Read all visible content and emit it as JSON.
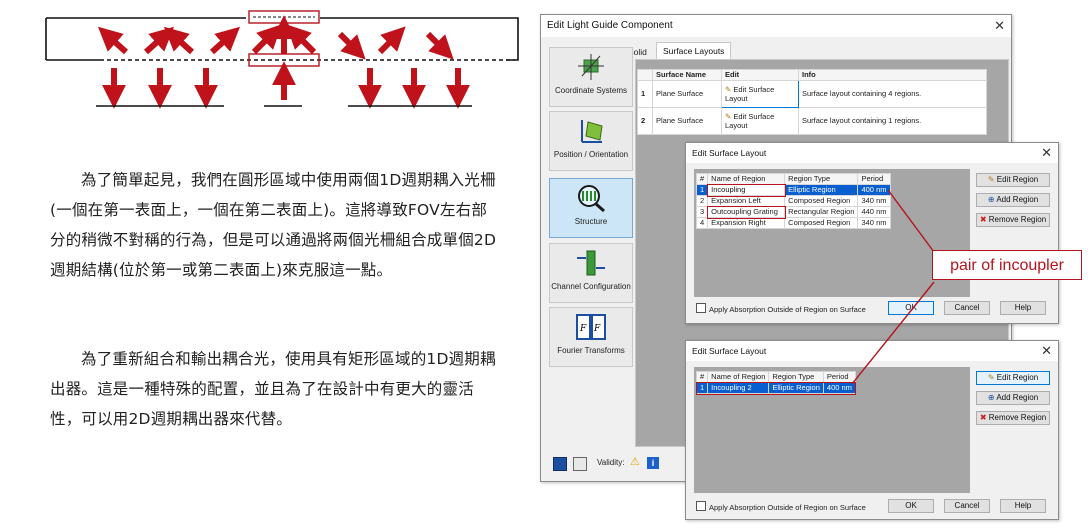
{
  "article": {
    "paragraph1": "為了簡單起見，我們在圓形區域中使用兩個1D週期耦入光柵(一個在第一表面上，一個在第二表面上)。這將導致FOV左右部分的稍微不對稱的行為，但是可以通過將兩個光柵組合成單個2D週期結構(位於第一或第二表面上)來克服這一點。",
    "paragraph2": "為了重新組合和輸出耦合光，使用具有矩形區域的1D週期耦出器。這是一種特殊的配置，並且為了在設計中有更大的靈活性，可以用2D週期耦出器來代替。"
  },
  "colors": {
    "arrow": "#c0121a",
    "annotation": "#b4141e",
    "selection": "#0a5fd0"
  },
  "main_dialog": {
    "title": "Edit Light Guide Component",
    "close": "✕",
    "tabs": [
      "Solid",
      "Surface Layouts"
    ],
    "sidebar": [
      {
        "label": "Coordinate Systems",
        "icon": "coordinate-axes-icon"
      },
      {
        "label": "Position / Orientation",
        "icon": "position-orientation-icon"
      },
      {
        "label": "Structure",
        "icon": "structure-magnifier-icon"
      },
      {
        "label": "Channel Configuration",
        "icon": "channel-icon"
      },
      {
        "label": "Fourier Transforms",
        "icon": "fourier-icon"
      }
    ],
    "table": {
      "headers": [
        "",
        "Surface Name",
        "Edit",
        "Info"
      ],
      "rows": [
        {
          "num": "1",
          "name": "Plane Surface",
          "edit": "Edit Surface Layout",
          "info": "Surface layout containing 4 regions."
        },
        {
          "num": "2",
          "name": "Plane Surface",
          "edit": "Edit Surface Layout",
          "info": "Surface layout containing 1 regions."
        }
      ]
    },
    "footer": {
      "validity_label": "Validity:"
    }
  },
  "layout_dialog_1": {
    "title": "Edit Surface Layout",
    "close": "✕",
    "headers": [
      "#",
      "Name of Region",
      "Region Type",
      "Period"
    ],
    "rows": [
      {
        "num": "1",
        "name": "Incoupling",
        "type": "Elliptic Region",
        "period": "400 nm"
      },
      {
        "num": "2",
        "name": "Expansion Left",
        "type": "Composed Region",
        "period": "340 nm"
      },
      {
        "num": "3",
        "name": "Outcoupling Grating",
        "type": "Rectangular Region",
        "period": "440 nm"
      },
      {
        "num": "4",
        "name": "Expansion Right",
        "type": "Composed Region",
        "period": "340 nm"
      }
    ],
    "buttons": {
      "edit": "Edit Region",
      "add": "Add Region",
      "remove": "Remove Region",
      "ok": "OK",
      "cancel": "Cancel",
      "help": "Help"
    },
    "checkbox": "Apply Absorption Outside of Region on Surface"
  },
  "layout_dialog_2": {
    "title": "Edit Surface Layout",
    "close": "✕",
    "headers": [
      "#",
      "Name of Region",
      "Region Type",
      "Period"
    ],
    "rows": [
      {
        "num": "1",
        "name": "Incoupling 2",
        "type": "Elliptic Region",
        "period": "400 nm"
      }
    ],
    "buttons": {
      "edit": "Edit Region",
      "add": "Add Region",
      "remove": "Remove Region",
      "ok": "OK",
      "cancel": "Cancel",
      "help": "Help"
    },
    "checkbox": "Apply Absorption Outside of Region on Surface"
  },
  "annotation": {
    "label": "pair of incoupler"
  }
}
